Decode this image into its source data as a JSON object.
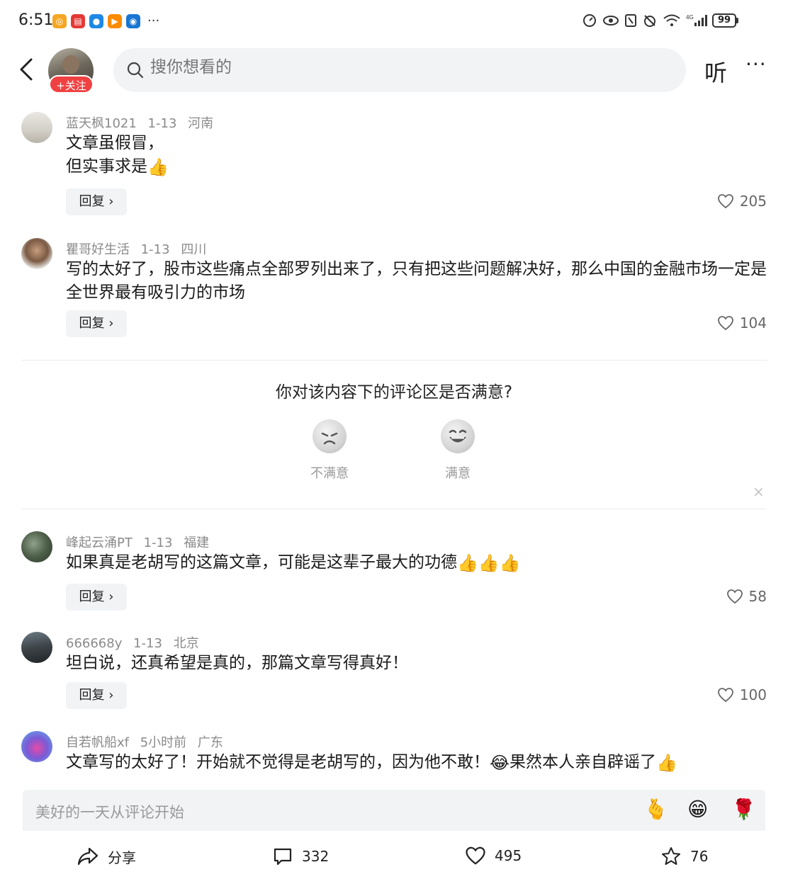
{
  "status_bar": {
    "time": "6:51",
    "battery": "99",
    "network": "4G"
  },
  "header": {
    "follow_label": "+关注",
    "search_placeholder": "搜你想看的",
    "listen_label": "听",
    "more_label": "···"
  },
  "comments": [
    {
      "user": "蓝天枫1021",
      "date": "1-13",
      "location": "河南",
      "text_lines": [
        "文章虽假冒，",
        "但实事求是"
      ],
      "reply_label": "回复 ›",
      "likes": "205"
    },
    {
      "user": "瞿哥好生活",
      "date": "1-13",
      "location": "四川",
      "text": "写的太好了，股市这些痛点全部罗列出来了，只有把这些问题解决好，那么中国的金融市场一定是全世界最有吸引力的市场",
      "reply_label": "回复 ›",
      "likes": "104"
    },
    {
      "user": "峰起云涌PT",
      "date": "1-13",
      "location": "福建",
      "text": "如果真是老胡写的这篇文章，可能是这辈子最大的功德",
      "reply_label": "回复 ›",
      "likes": "58"
    },
    {
      "user": "666668y",
      "date": "1-13",
      "location": "北京",
      "text": "坦白说，还真希望是真的，那篇文章写得真好！",
      "reply_label": "回复 ›",
      "likes": "100"
    },
    {
      "user": "自若帆船xf",
      "date": "5小时前",
      "location": "广东",
      "text_a": "文章写的太好了！开始就不觉得是老胡写的，因为他不敢！",
      "text_b": "果然本人亲自辟谣了"
    }
  ],
  "survey": {
    "question": "你对该内容下的评论区是否满意?",
    "options": [
      "不满意",
      "满意"
    ],
    "close": "×"
  },
  "input_bar": {
    "placeholder": "美好的一天从评论开始"
  },
  "bottom_bar": {
    "share_label": "分享",
    "comments_count": "332",
    "likes_count": "495",
    "favorites_count": "76"
  },
  "colors": {
    "follow_red": "#f04142",
    "search_bg": "#f2f3f5",
    "meta_gray": "#8a8a8a"
  },
  "icons": [
    "back-icon",
    "search-icon",
    "heart-icon",
    "share-icon",
    "comment-icon",
    "star-icon",
    "thumbs-up-icon"
  ]
}
